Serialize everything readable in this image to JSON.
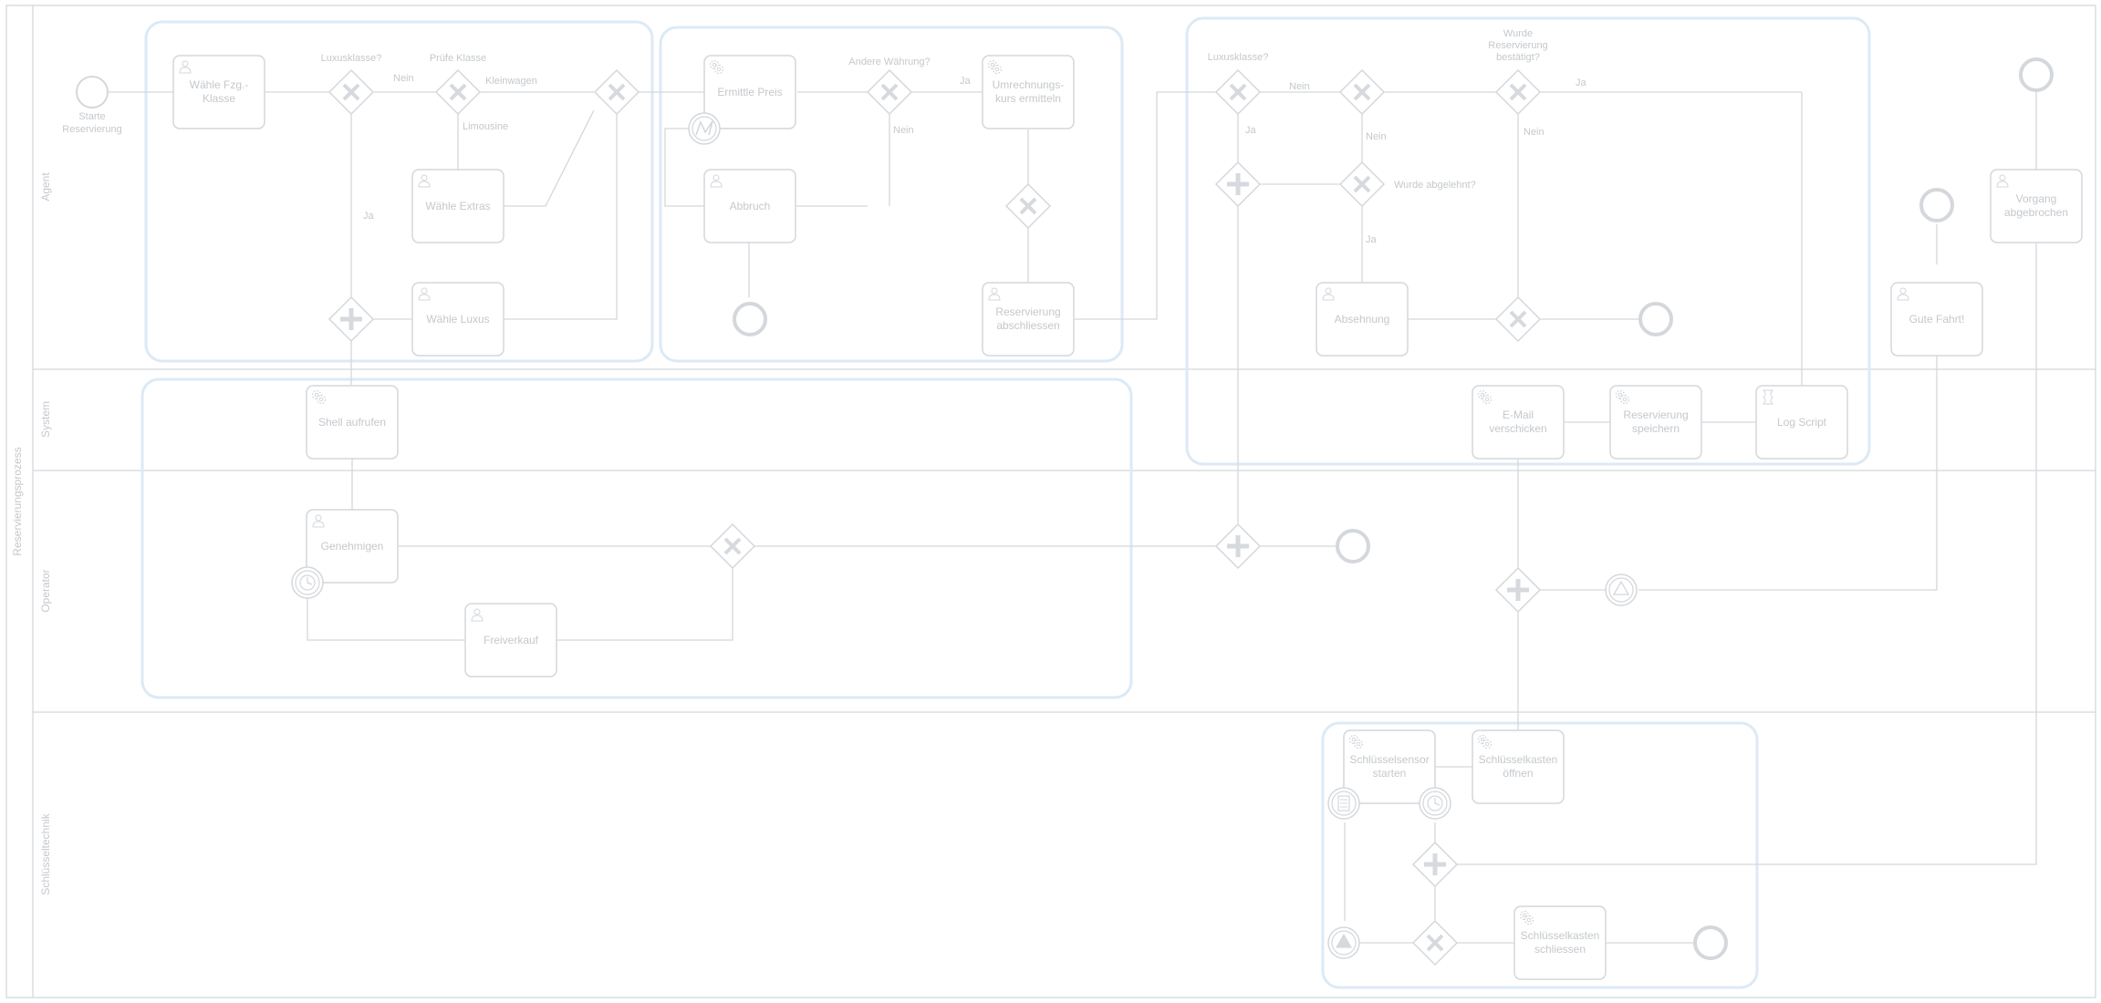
{
  "pool": {
    "label": "Reservierungsprozess"
  },
  "lanes": {
    "agent": "Agent",
    "system": "System",
    "operator": "Operator",
    "schluessel": "Schlüsseltechnik"
  },
  "events": {
    "start_label": [
      "Starte",
      "Reservierung"
    ]
  },
  "tasks": {
    "waehle_klasse": [
      "Wähle Fzg.-",
      "Klasse"
    ],
    "waehle_extras": [
      "Wähle Extras"
    ],
    "waehle_luxus": [
      "Wähle Luxus"
    ],
    "ermittle_preis": [
      "Ermittle Preis"
    ],
    "abbruch": [
      "Abbruch"
    ],
    "umrechnungskurs": [
      "Umrechnungs-",
      "kurs ermitteln"
    ],
    "reservierung_abschliessen": [
      "Reservierung",
      "abschliessen"
    ],
    "absehnung": [
      "Absehnung"
    ],
    "gute_fahrt": [
      "Gute Fahrt!"
    ],
    "vorgang_abgebrochen": [
      "Vorgang",
      "abgebrochen"
    ],
    "shell_aufrufen": [
      "Shell aufrufen"
    ],
    "email": [
      "E-Mail",
      "verschicken"
    ],
    "reservierung_speichern": [
      "Reservierung",
      "speichern"
    ],
    "log_script": [
      "Log Script"
    ],
    "genehmigen": [
      "Genehmigen"
    ],
    "freiverkauf": [
      "Freiverkauf"
    ],
    "schluesselsensor": [
      "Schlüsselsensor",
      "starten"
    ],
    "schluesselkasten_oeffnen": [
      "Schlüsselkasten",
      "öffnen"
    ],
    "schluesselkasten_schliessen": [
      "Schlüsselkasten",
      "schliessen"
    ]
  },
  "gateway_labels": {
    "luxusklasse_1": "Luxusklasse?",
    "pruefe_klasse": "Prüfe Klasse",
    "andere_waehrung": "Andere Währung?",
    "luxusklasse_2": "Luxusklasse?",
    "wurde_bestaetigt": [
      "Wurde",
      "Reservierung",
      "bestätigt?"
    ],
    "wurde_abgelehnt": "Wurde abgelehnt?"
  },
  "flow_labels": {
    "nein_1": "Nein",
    "kleinwagen": "Kleinwagen",
    "limousine": "Limousine",
    "ja_1": "Ja",
    "ja_2": "Ja",
    "nein_2": "Nein",
    "nein_3": "Nein",
    "ja_3": "Ja",
    "nein_4": "Nein",
    "ja_4": "Ja",
    "ja_5": "Ja",
    "nein_5": "Nein"
  },
  "colors": {
    "stroke": "#d4d7db",
    "text": "#c4c8cc",
    "group_border": "#dceaf5",
    "gateway_mark": "#d6d9dd"
  }
}
